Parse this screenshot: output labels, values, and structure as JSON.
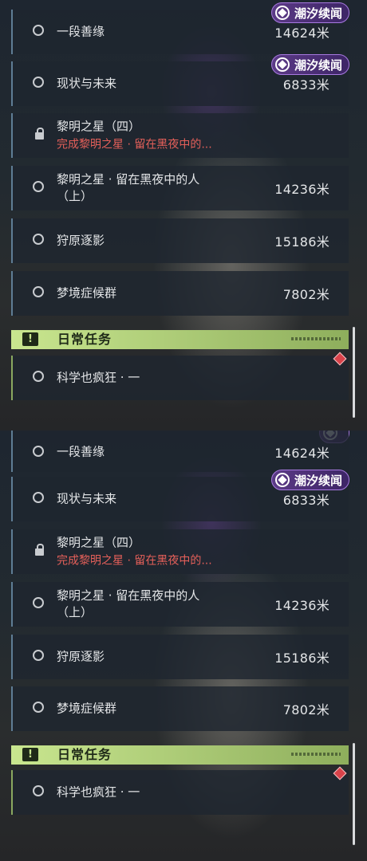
{
  "copies": [
    {
      "quests": [
        {
          "name": "一段善缘",
          "sub": "",
          "distance": "14624米",
          "icon": "circle-icon",
          "tag": "潮汐续闻"
        },
        {
          "name": "现状与未来",
          "sub": "",
          "distance": "6833米",
          "icon": "circle-icon",
          "tag": "潮汐续闻"
        },
        {
          "name": "黎明之星（四）",
          "sub": "完成黎明之星 · 留在黑夜中的...",
          "distance": "",
          "icon": "lock-icon",
          "tag": ""
        },
        {
          "name": "黎明之星 · 留在黑夜中的人（上）",
          "sub": "",
          "distance": "14236米",
          "icon": "circle-icon",
          "tag": ""
        },
        {
          "name": "狩原逐影",
          "sub": "",
          "distance": "15186米",
          "icon": "circle-icon",
          "tag": ""
        },
        {
          "name": "梦境症候群",
          "sub": "",
          "distance": "7802米",
          "icon": "circle-icon",
          "tag": ""
        }
      ],
      "section_title": "日常任务",
      "daily": {
        "name": "科学也疯狂 · 一"
      }
    },
    {
      "quests": [
        {
          "name": "一段善缘",
          "sub": "",
          "distance": "14624米",
          "icon": "circle-icon",
          "tag": ""
        },
        {
          "name": "现状与未来",
          "sub": "",
          "distance": "6833米",
          "icon": "circle-icon",
          "tag": "潮汐续闻"
        },
        {
          "name": "黎明之星（四）",
          "sub": "完成黎明之星 · 留在黑夜中的...",
          "distance": "",
          "icon": "lock-icon",
          "tag": ""
        },
        {
          "name": "黎明之星 · 留在黑夜中的人（上）",
          "sub": "",
          "distance": "14236米",
          "icon": "circle-icon",
          "tag": ""
        },
        {
          "name": "狩原逐影",
          "sub": "",
          "distance": "15186米",
          "icon": "circle-icon",
          "tag": ""
        },
        {
          "name": "梦境症候群",
          "sub": "",
          "distance": "7802米",
          "icon": "circle-icon",
          "tag": ""
        }
      ],
      "section_title": "日常任务",
      "daily": {
        "name": "科学也疯狂 · 一"
      }
    }
  ],
  "colors": {
    "accent_daily": "#c9e68f",
    "locked_text": "#e6605a",
    "tag_purple": "#5b3a86",
    "marker_red": "#d9424a"
  }
}
